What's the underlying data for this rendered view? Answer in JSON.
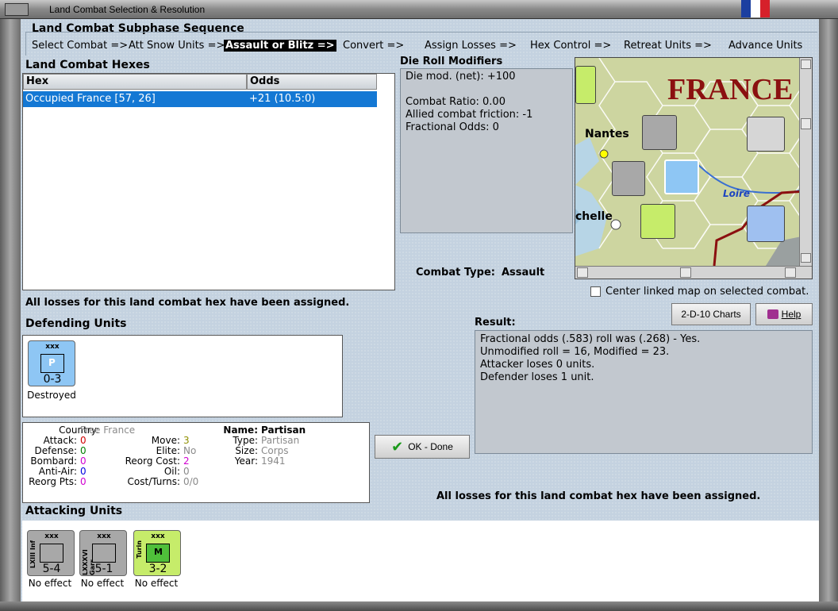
{
  "window": {
    "title": "Land Combat Selection & Resolution"
  },
  "subphase": {
    "heading": "Land Combat Subphase Sequence",
    "steps": [
      "Select Combat =>",
      "Att Snow Units =>",
      "Assault or Blitz =>",
      "Convert =>",
      "Assign Losses =>",
      "Hex Control =>",
      "Retreat Units =>",
      "Advance Units"
    ]
  },
  "hexes": {
    "heading": "Land Combat Hexes",
    "col_hex": "Hex",
    "col_odds": "Odds",
    "rows": [
      {
        "hex": "Occupied France [57, 26]",
        "odds": "+21 (10.5:0)"
      }
    ]
  },
  "die": {
    "heading": "Die Roll Modifiers",
    "lines": [
      "Die mod. (net): +100",
      "",
      "Combat Ratio: 0.00",
      "Allied combat friction: -1",
      "Fractional Odds: 0"
    ]
  },
  "combat_type": {
    "label": "Combat Type:",
    "value": "Assault"
  },
  "map": {
    "label_france": "FRANCE",
    "label_nantes": "Nantes",
    "label_loire": "Loire",
    "label_chelle": "chelle",
    "center_label": "Center linked map on selected combat."
  },
  "buttons": {
    "charts": "2-D-10 Charts",
    "help": "Help",
    "ok": "OK - Done"
  },
  "losses_note_top": "All losses for this land combat hex have been assigned.",
  "losses_note_bottom": "All losses for this land combat hex have been assigned.",
  "defending": {
    "heading": "Defending Units",
    "units": [
      {
        "size": "xxx",
        "symbol": "P",
        "strength": "0-3",
        "status": "Destroyed"
      }
    ]
  },
  "result": {
    "heading": "Result:",
    "lines": [
      "Fractional odds (.583) roll was (.268)  - Yes.",
      "Unmodified roll = 16, Modified = 23.",
      "Attacker loses 0 units.",
      "Defender loses 1 unit."
    ]
  },
  "details": {
    "country_l": "Country:",
    "country_v": "Free France",
    "attack_l": "Attack:",
    "attack_v": "0",
    "defense_l": "Defense:",
    "defense_v": "0",
    "bombard_l": "Bombard:",
    "bombard_v": "0",
    "antiair_l": "Anti-Air:",
    "antiair_v": "0",
    "reorgpts_l": "Reorg Pts:",
    "reorgpts_v": "0",
    "move_l": "Move:",
    "move_v": "3",
    "elite_l": "Elite:",
    "elite_v": "No",
    "reorgcost_l": "Reorg Cost:",
    "reorgcost_v": "2",
    "oil_l": "Oil:",
    "oil_v": "0",
    "cost_l": "Cost/Turns:",
    "cost_v": "0/0",
    "name_l": "Name:",
    "name_v": "Partisan",
    "type_l": "Type:",
    "type_v": "Partisan",
    "size_l": "Size:",
    "size_v": "Corps",
    "year_l": "Year:",
    "year_v": "1941"
  },
  "attacking": {
    "heading": "Attacking Units",
    "units": [
      {
        "size": "xxx",
        "side": "LXIII Inf",
        "strength": "5-4",
        "status": "No effect"
      },
      {
        "size": "xxx",
        "side": "LXXXVI Garr",
        "strength": "5-1",
        "status": "No effect"
      },
      {
        "size": "xxx",
        "side": "Turin",
        "symbol": "M",
        "strength": "3-2",
        "status": "No effect"
      }
    ]
  },
  "colors": {
    "german_grey": "#a8a8a8",
    "italian_green": "#c6ec6a",
    "allied_blue": "#8ec6f4",
    "selection": "#1478d4"
  }
}
